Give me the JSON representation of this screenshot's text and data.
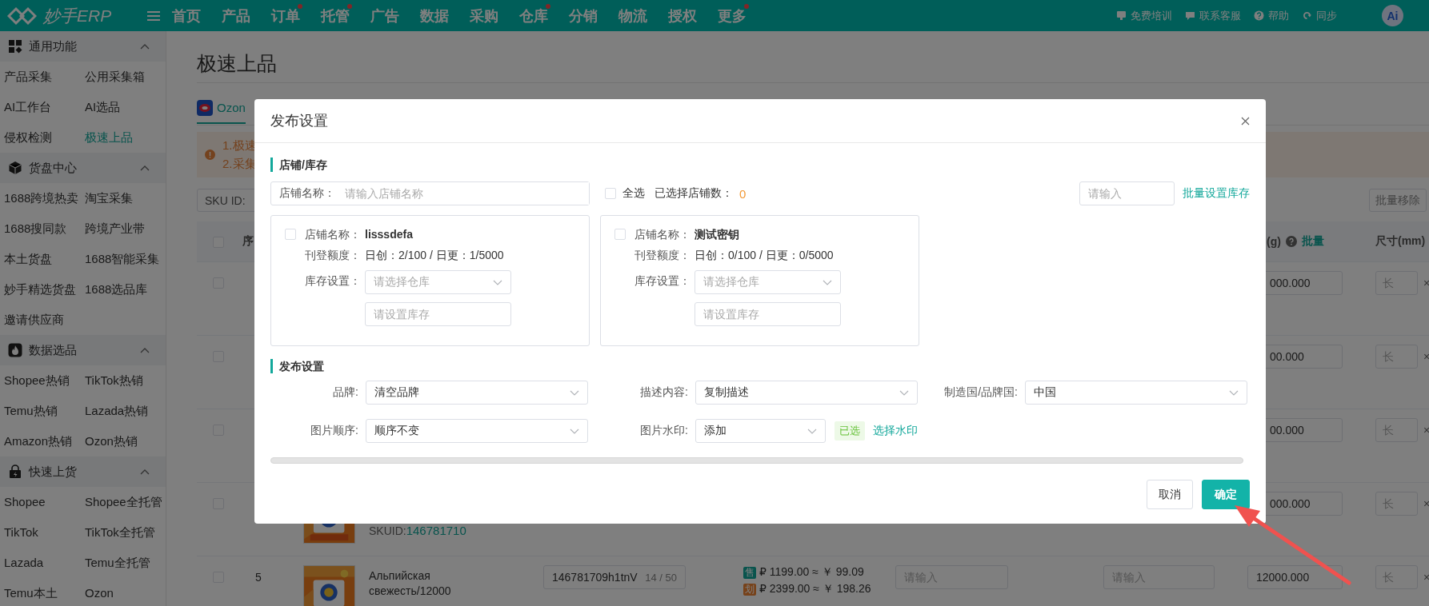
{
  "topbar": {
    "logo": "妙手ERP",
    "nav": [
      {
        "label": "首页",
        "badge": false
      },
      {
        "label": "产品",
        "badge": false
      },
      {
        "label": "订单",
        "badge": true
      },
      {
        "label": "托管",
        "badge": true
      },
      {
        "label": "广告",
        "badge": false
      },
      {
        "label": "数据",
        "badge": false
      },
      {
        "label": "采购",
        "badge": false
      },
      {
        "label": "仓库",
        "badge": true
      },
      {
        "label": "分销",
        "badge": false
      },
      {
        "label": "物流",
        "badge": false
      },
      {
        "label": "授权",
        "badge": false
      },
      {
        "label": "更多",
        "badge": true
      }
    ],
    "tools": [
      {
        "label": "免费培训"
      },
      {
        "label": "联系客服"
      },
      {
        "label": "帮助"
      },
      {
        "label": "同步"
      }
    ],
    "avatar": "Ai"
  },
  "sidebar": {
    "sections": [
      {
        "title": "通用功能",
        "expanded": true,
        "items": [
          {
            "label": "产品采集",
            "selected": false
          },
          {
            "label": "公用采集箱",
            "selected": false
          },
          {
            "label": "AI工作台",
            "selected": false
          },
          {
            "label": "AI选品",
            "selected": false
          },
          {
            "label": "侵权检测",
            "selected": false
          },
          {
            "label": "极速上品",
            "selected": true
          }
        ]
      },
      {
        "title": "货盘中心",
        "expanded": true,
        "items": [
          {
            "label": "1688跨境热卖",
            "selected": false
          },
          {
            "label": "淘宝采集",
            "selected": false
          },
          {
            "label": "1688搜同款",
            "selected": false
          },
          {
            "label": "跨境产业带",
            "selected": false
          },
          {
            "label": "本土货盘",
            "selected": false
          },
          {
            "label": "1688智能采集",
            "selected": false
          },
          {
            "label": "妙手精选货盘",
            "selected": false
          },
          {
            "label": "1688选品库",
            "selected": false
          },
          {
            "label": "邀请供应商",
            "selected": false
          }
        ]
      },
      {
        "title": "数据选品",
        "expanded": true,
        "items": [
          {
            "label": "Shopee热销",
            "selected": false
          },
          {
            "label": "TikTok热销",
            "selected": false
          },
          {
            "label": "Temu热销",
            "selected": false
          },
          {
            "label": "Lazada热销",
            "selected": false
          },
          {
            "label": "Amazon热销",
            "selected": false
          },
          {
            "label": "Ozon热销",
            "selected": false
          }
        ]
      },
      {
        "title": "快速上货",
        "expanded": true,
        "items": [
          {
            "label": "Shopee",
            "selected": false
          },
          {
            "label": "Shopee全托管",
            "selected": false
          },
          {
            "label": "TikTok",
            "selected": false
          },
          {
            "label": "TikTok全托管",
            "selected": false
          },
          {
            "label": "Lazada",
            "selected": false
          },
          {
            "label": "Temu全托管",
            "selected": false
          },
          {
            "label": "Temu本土",
            "selected": false
          },
          {
            "label": "Ozon",
            "selected": false
          }
        ]
      }
    ]
  },
  "page": {
    "title": "极速上品",
    "tabs": [
      {
        "label": "Ozon",
        "selected": true
      }
    ],
    "notice": [
      "1.极速",
      "2.采集"
    ],
    "sku_label": "SKU ID:",
    "batch_remove": "批量移除",
    "table": {
      "header": {
        "checked": false,
        "index": "序",
        "weight": "(g)",
        "weight_action": "批量",
        "size": "尺寸(mm)"
      },
      "rows": [
        {
          "checked": false,
          "weight": "000.000",
          "length_placeholder": "长",
          "size_separator": "×"
        },
        {
          "checked": false,
          "weight": "00.000",
          "length_placeholder": "长",
          "size_separator": "×"
        },
        {
          "checked": false,
          "weight": "00.000",
          "length_placeholder": "长",
          "size_separator": "×"
        },
        {
          "checked": false,
          "sku_label": "SKUID:",
          "sku_id": "146781710",
          "weight": "000.000",
          "length_placeholder": "长",
          "size_separator": "×"
        },
        {
          "checked": false,
          "index": "5",
          "name": "Альпийская свежесть/12000",
          "sku_code": "146781709h1tnV",
          "sku_count": "14 / 50",
          "prices": [
            {
              "tag": "售",
              "kind": "sale",
              "text": "₽ 1199.00 ≈ ￥ 99.09"
            },
            {
              "tag": "划",
              "kind": "original",
              "text": "₽ 2399.00 ≈ ￥ 198.26"
            }
          ],
          "field_a_placeholder": "请输入",
          "field_b_placeholder": "请输入",
          "weight": "12000.000",
          "length_placeholder": "长",
          "size_separator": "×"
        }
      ]
    }
  },
  "dialog": {
    "title": "发布设置",
    "store_section": {
      "title": "店铺/库存",
      "search": {
        "label": "店铺名称：",
        "placeholder": "请输入店铺名称"
      },
      "select_all": {
        "label": "全选",
        "checked": false
      },
      "selected_count": {
        "label": "已选择店铺数：",
        "value": "0"
      },
      "bulk_stock": {
        "placeholder": "请输入",
        "action": "批量设置库存"
      },
      "stores": [
        {
          "checked": false,
          "name_label": "店铺名称：",
          "name": "lisssdefa",
          "quota_label": "刊登额度：",
          "quota": "日创：2/100 / 日更：1/5000",
          "stock_label": "库存设置：",
          "warehouse_placeholder": "请选择仓库",
          "stock_placeholder": "请设置库存"
        },
        {
          "checked": false,
          "name_label": "店铺名称：",
          "name": "测试密钥",
          "quota_label": "刊登额度：",
          "quota": "日创：0/100 / 日更：0/5000",
          "stock_label": "库存设置：",
          "warehouse_placeholder": "请选择仓库",
          "stock_placeholder": "请设置库存"
        }
      ]
    },
    "publish_section": {
      "title": "发布设置",
      "fields": [
        {
          "label": "品牌:",
          "value": "清空品牌"
        },
        {
          "label": "描述内容:",
          "value": "复制描述"
        },
        {
          "label": "制造国/品牌国:",
          "value": "中国"
        },
        {
          "label": "图片顺序:",
          "value": "顺序不变"
        },
        {
          "label": "图片水印:",
          "value": "添加",
          "tag": "已选",
          "action": "选择水印"
        }
      ]
    },
    "buttons": [
      {
        "label": "取消",
        "kind": "default"
      },
      {
        "label": "确定",
        "kind": "primary"
      }
    ]
  }
}
